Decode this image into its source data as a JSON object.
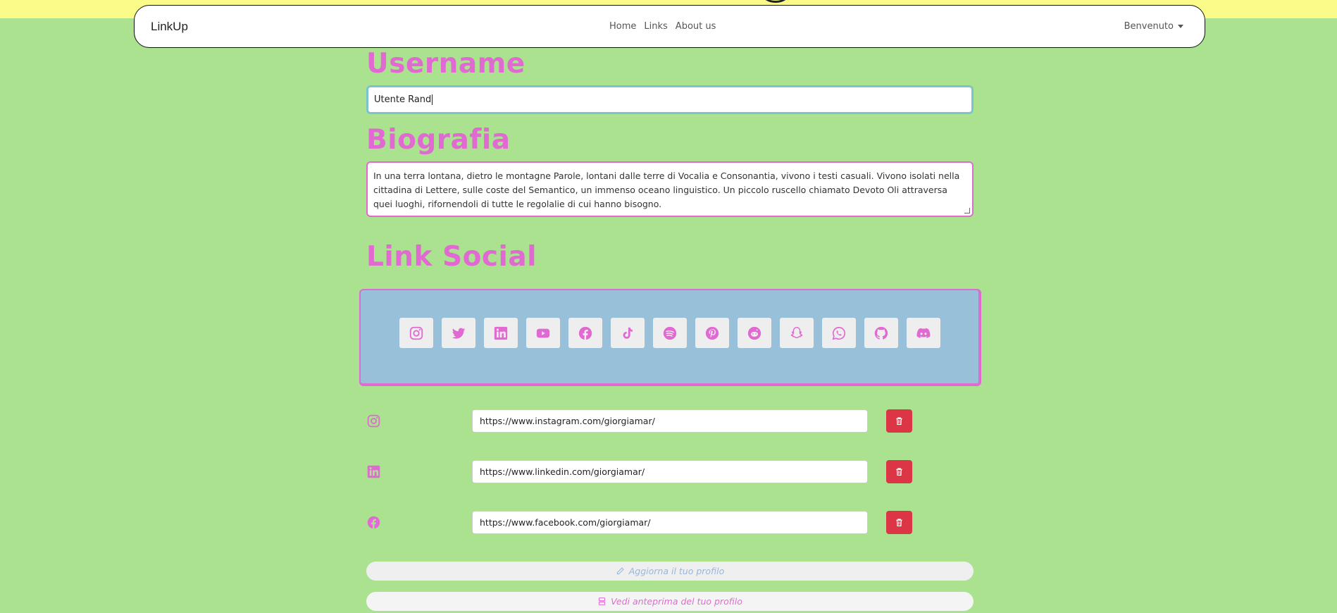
{
  "navbar": {
    "brand": "LinkUp",
    "links": [
      "Home",
      "Links",
      "About us"
    ],
    "user_menu": "Benvenuto"
  },
  "profile": {
    "username_heading": "Username",
    "username_value": "Utente Rand",
    "bio_heading": "Biografia",
    "bio_value": "In una terra lontana, dietro le montagne Parole, lontani dalle terre di Vocalia e Consonantia, vivono i testi casuali. Vivono isolati nella cittadina di Lettere, sulle coste del Semantico, un immenso oceano linguistico. Un piccolo ruscello chiamato Devoto Oli attraversa quei luoghi, rifornendoli di tutte le regolalie di cui hanno bisogno.",
    "social_heading": "Link Social"
  },
  "social_tiles": [
    "instagram-icon",
    "twitter-icon",
    "linkedin-icon",
    "youtube-icon",
    "facebook-icon",
    "tiktok-icon",
    "spotify-icon",
    "pinterest-icon",
    "reddit-icon",
    "snapchat-icon",
    "whatsapp-icon",
    "github-icon",
    "discord-icon"
  ],
  "links": [
    {
      "icon": "instagram-icon",
      "url": "https://www.instagram.com/giorgiamar/"
    },
    {
      "icon": "linkedin-icon",
      "url": "https://www.linkedin.com/giorgiamar/"
    },
    {
      "icon": "facebook-icon",
      "url": "https://www.facebook.com/giorgiamar/"
    }
  ],
  "actions": {
    "update_label": "Aggiorna il tuo profilo",
    "preview_label": "Vedi anteprima del tuo profilo"
  },
  "colors": {
    "background": "#aae28f",
    "accent": "#e06ad1",
    "panel": "#98c1d9",
    "danger": "#dc3545",
    "top_band": "#fbfb8a"
  }
}
